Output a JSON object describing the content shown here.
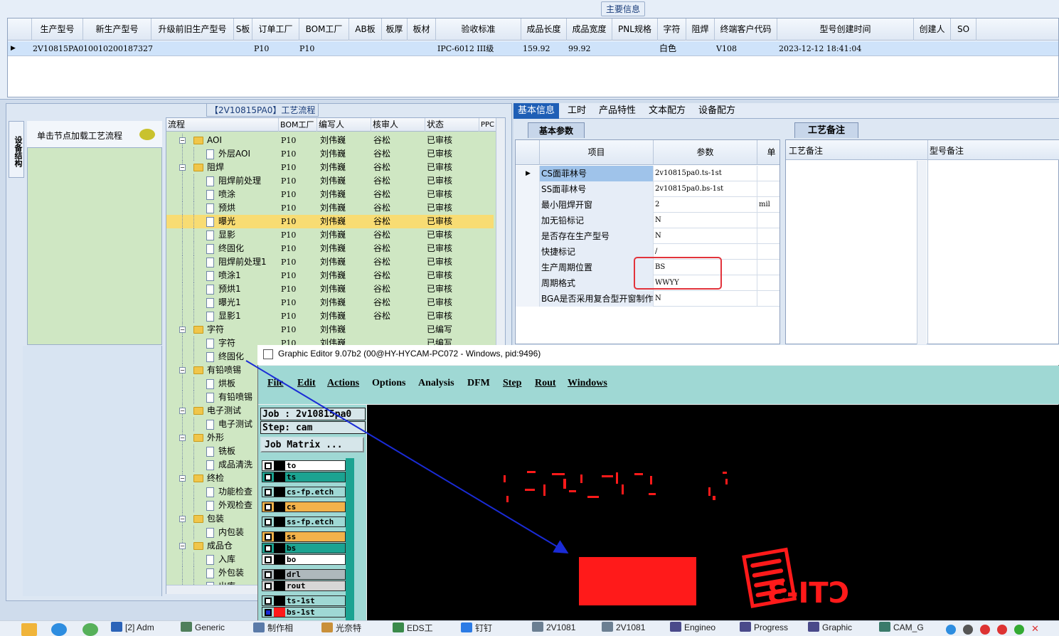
{
  "top": {
    "title": "主要信息",
    "columns": [
      "生产型号",
      "新生产型号",
      "升级前旧生产型号",
      "S板",
      "订单工厂",
      "BOM工厂",
      "AB板",
      "板厚",
      "板材",
      "验收标准",
      "成品长度",
      "成品宽度",
      "PNL规格",
      "字符",
      "阻焊",
      "终端客户代码",
      "型号创建时间",
      "创建人",
      "SO"
    ],
    "row": {
      "prod_model": "2V10815PA0",
      "new_model": "10010200187327",
      "order_factory": "P10",
      "bom_factory": "P10",
      "standard": "IPC-6012 III级",
      "length": "159.92",
      "width": "99.92",
      "char": "白色",
      "customer_code": "V108",
      "created": "2023-12-12 18:41:04"
    }
  },
  "left": {
    "side_tab": "设备结构",
    "load_label": "单击节点加载工艺流程",
    "flow_title": "【2V10815PA0】工艺流程",
    "tree_headers": [
      "流程",
      "BOM工厂",
      "编写人",
      "核审人",
      "状态",
      "PPC"
    ],
    "tree_rows": [
      {
        "name": "AOI",
        "type": "folder",
        "level": 0,
        "bom": "P10",
        "writer": "刘伟巍",
        "reviewer": "谷松",
        "status": "已审核"
      },
      {
        "name": "外层AOI",
        "type": "doc",
        "level": 1,
        "bom": "P10",
        "writer": "刘伟巍",
        "reviewer": "谷松",
        "status": "已审核"
      },
      {
        "name": "阻焊",
        "type": "folder",
        "level": 0,
        "bom": "P10",
        "writer": "刘伟巍",
        "reviewer": "谷松",
        "status": "已审核"
      },
      {
        "name": "阻焊前处理",
        "type": "doc",
        "level": 1,
        "bom": "P10",
        "writer": "刘伟巍",
        "reviewer": "谷松",
        "status": "已审核"
      },
      {
        "name": "喷涂",
        "type": "doc",
        "level": 1,
        "bom": "P10",
        "writer": "刘伟巍",
        "reviewer": "谷松",
        "status": "已审核"
      },
      {
        "name": "预烘",
        "type": "doc",
        "level": 1,
        "bom": "P10",
        "writer": "刘伟巍",
        "reviewer": "谷松",
        "status": "已审核"
      },
      {
        "name": "曝光",
        "type": "doc",
        "level": 1,
        "bom": "P10",
        "writer": "刘伟巍",
        "reviewer": "谷松",
        "status": "已审核",
        "selected": true
      },
      {
        "name": "显影",
        "type": "doc",
        "level": 1,
        "bom": "P10",
        "writer": "刘伟巍",
        "reviewer": "谷松",
        "status": "已审核"
      },
      {
        "name": "终固化",
        "type": "doc",
        "level": 1,
        "bom": "P10",
        "writer": "刘伟巍",
        "reviewer": "谷松",
        "status": "已审核"
      },
      {
        "name": "阻焊前处理1",
        "type": "doc",
        "level": 1,
        "bom": "P10",
        "writer": "刘伟巍",
        "reviewer": "谷松",
        "status": "已审核"
      },
      {
        "name": "喷涂1",
        "type": "doc",
        "level": 1,
        "bom": "P10",
        "writer": "刘伟巍",
        "reviewer": "谷松",
        "status": "已审核"
      },
      {
        "name": "预烘1",
        "type": "doc",
        "level": 1,
        "bom": "P10",
        "writer": "刘伟巍",
        "reviewer": "谷松",
        "status": "已审核"
      },
      {
        "name": "曝光1",
        "type": "doc",
        "level": 1,
        "bom": "P10",
        "writer": "刘伟巍",
        "reviewer": "谷松",
        "status": "已审核"
      },
      {
        "name": "显影1",
        "type": "doc",
        "level": 1,
        "bom": "P10",
        "writer": "刘伟巍",
        "reviewer": "谷松",
        "status": "已审核"
      },
      {
        "name": "字符",
        "type": "folder",
        "level": 0,
        "bom": "P10",
        "writer": "刘伟巍",
        "reviewer": "",
        "status": "已编写"
      },
      {
        "name": "字符",
        "type": "doc",
        "level": 1,
        "bom": "P10",
        "writer": "刘伟巍",
        "reviewer": "",
        "status": "已编写"
      },
      {
        "name": "终固化",
        "type": "doc",
        "level": 1,
        "bom": "",
        "writer": "",
        "reviewer": "",
        "status": ""
      },
      {
        "name": "有铅喷锡",
        "type": "folder",
        "level": 0,
        "bom": "",
        "writer": "",
        "reviewer": "",
        "status": ""
      },
      {
        "name": "烘板",
        "type": "doc",
        "level": 1,
        "bom": "",
        "writer": "",
        "reviewer": "",
        "status": ""
      },
      {
        "name": "有铅喷锡",
        "type": "doc",
        "level": 1,
        "bom": "",
        "writer": "",
        "reviewer": "",
        "status": ""
      },
      {
        "name": "电子测试",
        "type": "folder",
        "level": 0,
        "bom": "",
        "writer": "",
        "reviewer": "",
        "status": ""
      },
      {
        "name": "电子测试",
        "type": "doc",
        "level": 1,
        "bom": "",
        "writer": "",
        "reviewer": "",
        "status": ""
      },
      {
        "name": "外形",
        "type": "folder",
        "level": 0,
        "bom": "",
        "writer": "",
        "reviewer": "",
        "status": ""
      },
      {
        "name": "铣板",
        "type": "doc",
        "level": 1,
        "bom": "",
        "writer": "",
        "reviewer": "",
        "status": ""
      },
      {
        "name": "成品清洗",
        "type": "doc",
        "level": 1,
        "bom": "",
        "writer": "",
        "reviewer": "",
        "status": ""
      },
      {
        "name": "终检",
        "type": "folder",
        "level": 0,
        "bom": "",
        "writer": "",
        "reviewer": "",
        "status": ""
      },
      {
        "name": "功能检查",
        "type": "doc",
        "level": 1,
        "bom": "",
        "writer": "",
        "reviewer": "",
        "status": ""
      },
      {
        "name": "外观检查",
        "type": "doc",
        "level": 1,
        "bom": "",
        "writer": "",
        "reviewer": "",
        "status": ""
      },
      {
        "name": "包装",
        "type": "folder",
        "level": 0,
        "bom": "",
        "writer": "",
        "reviewer": "",
        "status": ""
      },
      {
        "name": "内包装",
        "type": "doc",
        "level": 1,
        "bom": "",
        "writer": "",
        "reviewer": "",
        "status": ""
      },
      {
        "name": "成品仓",
        "type": "folder",
        "level": 0,
        "bom": "",
        "writer": "",
        "reviewer": "",
        "status": ""
      },
      {
        "name": "入库",
        "type": "doc",
        "level": 1,
        "bom": "",
        "writer": "",
        "reviewer": "",
        "status": ""
      },
      {
        "name": "外包装",
        "type": "doc",
        "level": 1,
        "bom": "",
        "writer": "",
        "reviewer": "",
        "status": ""
      },
      {
        "name": "出库",
        "type": "doc",
        "level": 1,
        "bom": "",
        "writer": "",
        "reviewer": "",
        "status": ""
      }
    ]
  },
  "right": {
    "tabs": [
      "基本信息",
      "工时",
      "产品特性",
      "文本配方",
      "设备配方"
    ],
    "basic_tab": "基本参数",
    "param_headers": [
      "项目",
      "参数",
      "单"
    ],
    "params": [
      {
        "item": "CS面菲林号",
        "value": "2v10815pa0.ts-1st",
        "unit": ""
      },
      {
        "item": "SS面菲林号",
        "value": "2v10815pa0.bs-1st",
        "unit": ""
      },
      {
        "item": "最小阻焊开窗",
        "value": "2",
        "unit": "mil"
      },
      {
        "item": "加无铅标记",
        "value": "N",
        "unit": ""
      },
      {
        "item": "是否存在生产型号",
        "value": "N",
        "unit": ""
      },
      {
        "item": "快捷标记",
        "value": "/",
        "unit": ""
      },
      {
        "item": "生产周期位置",
        "value": "BS",
        "unit": ""
      },
      {
        "item": "周期格式",
        "value": "WWYY",
        "unit": ""
      },
      {
        "item": "BGA是否采用复合型开窗制作",
        "value": "N",
        "unit": ""
      }
    ],
    "proc_tab": "工艺备注",
    "notes_headers": [
      "工艺备注",
      "型号备注"
    ]
  },
  "ge": {
    "title": "Graphic Editor 9.07b2 (00@HY-HYCAM-PC072 - Windows, pid:9496)",
    "menus": [
      "File",
      "Edit",
      "Actions",
      "Options",
      "Analysis",
      "DFM",
      "Step",
      "Rout",
      "Windows"
    ],
    "job": "Job : 2v10815pa0",
    "step": "Step: cam",
    "job_matrix": "Job Matrix ...",
    "layers": [
      {
        "name": "to",
        "color": "#ffffff",
        "bar": "#ffffff"
      },
      {
        "name": "ts",
        "color": "#1ba391",
        "bar": "#1ba391"
      },
      {
        "name": "cs-fp.etch",
        "color": "#9fd8d4",
        "bar": "#9fd8d4"
      },
      {
        "name": "cs",
        "color": "#f2b24a",
        "bar": "#f2b24a"
      },
      {
        "name": "ss-fp.etch",
        "color": "#9fd8d4",
        "bar": "#9fd8d4"
      },
      {
        "name": "ss",
        "color": "#f2b24a",
        "bar": "#f2b24a"
      },
      {
        "name": "bs",
        "color": "#1ba391",
        "bar": "#1ba391"
      },
      {
        "name": "bo",
        "color": "#ffffff",
        "bar": "#ffffff"
      },
      {
        "name": "drl",
        "color": "#aeb8bc",
        "bar": "#aeb8bc"
      },
      {
        "name": "rout",
        "color": "#d6d6d6",
        "bar": "#d6d6d6"
      },
      {
        "name": "ts-1st",
        "color": "#9fd8d4",
        "bar": "#9fd8d4"
      },
      {
        "name": "bs-1st",
        "color": "#9fd8d4",
        "bar": "#9fd8d4",
        "active": true
      }
    ],
    "canvas_text": "CTI-3"
  },
  "taskbar": [
    {
      "label": "[2] Adm",
      "color": "#2b63b8"
    },
    {
      "label": "Generic",
      "color": "#4f7f5b"
    },
    {
      "label": "制作相",
      "color": "#5a7aa8"
    },
    {
      "label": "光奈特",
      "color": "#c9903a"
    },
    {
      "label": "EDS工",
      "color": "#3a8a4a"
    },
    {
      "label": "钉钉",
      "color": "#2c7be5"
    },
    {
      "label": "2V1081",
      "color": "#6b7f92"
    },
    {
      "label": "2V1081",
      "color": "#6b7f92"
    },
    {
      "label": "Engineo",
      "color": "#4a4a8a"
    },
    {
      "label": "Progress",
      "color": "#4a4a8a"
    },
    {
      "label": "Graphic",
      "color": "#4a4a8a"
    },
    {
      "label": "CAM_G",
      "color": "#3a7a6a"
    }
  ]
}
